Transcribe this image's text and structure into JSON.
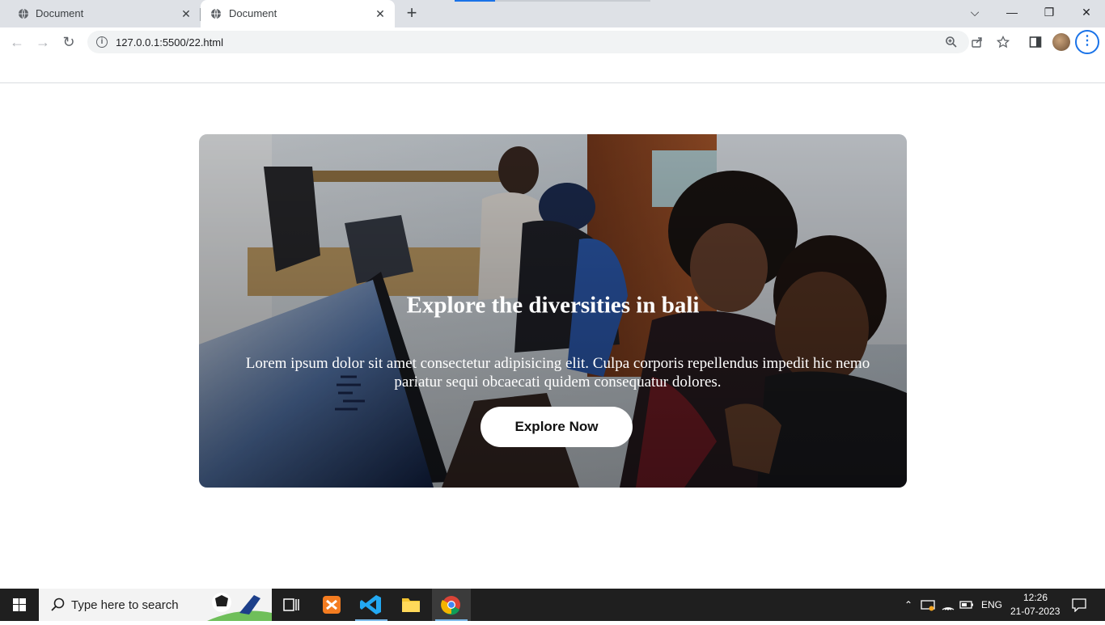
{
  "browser": {
    "tabs": [
      {
        "title": "Document",
        "active": false
      },
      {
        "title": "Document",
        "active": true
      }
    ],
    "new_tab_symbol": "+",
    "url": "127.0.0.1:5500/22.html",
    "info_symbol": "i",
    "window_controls": {
      "list": "⌵",
      "minimize": "—",
      "maximize": "❐",
      "close": "✕"
    },
    "icons": [
      "globe-icon",
      "close-icon",
      "back-icon",
      "forward-icon",
      "reload-icon",
      "zoom-icon",
      "share-icon",
      "star-icon",
      "side-panel-icon",
      "avatar",
      "menu-icon"
    ]
  },
  "hero": {
    "title": "Explore the diversities in bali",
    "text": "Lorem ipsum dolor sit amet consectetur adipisicing elit. Culpa corporis repellendus impedit hic nemo pariatur sequi obcaecati quidem consequatur dolores.",
    "button_label": "Explore Now",
    "colors": {
      "text": "#ffffff",
      "button_bg": "#ffffff",
      "button_text": "#111111"
    }
  },
  "taskbar": {
    "search_placeholder": "Type here to search",
    "apps": [
      "task-view",
      "xampp",
      "vscode",
      "file-explorer",
      "chrome"
    ],
    "active_app": "chrome",
    "tray": {
      "language": "ENG",
      "time": "12:26",
      "date": "21-07-2023"
    }
  }
}
